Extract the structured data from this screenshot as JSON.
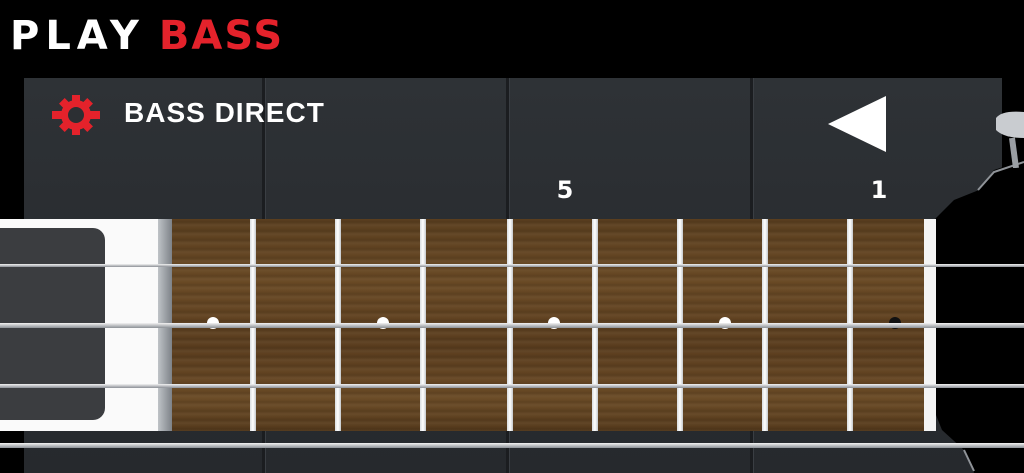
{
  "brand": {
    "word1": "PLAY",
    "word2": "BASS"
  },
  "settings": {
    "icon": "gear-icon",
    "label": "BASS DIRECT"
  },
  "back": {
    "icon": "back-triangle-icon"
  },
  "fret_markers": [
    "5",
    "1"
  ],
  "colors": {
    "accent": "#e4222b",
    "background": "#000000",
    "panel": "#2b2e32",
    "wood": "#5f4221"
  }
}
